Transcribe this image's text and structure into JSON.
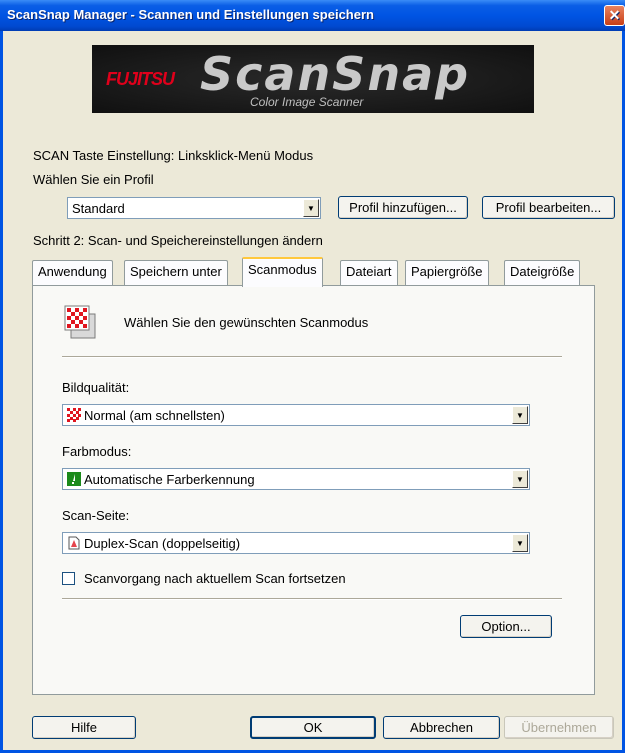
{
  "window": {
    "title": "ScanSnap Manager - Scannen und Einstellungen speichern",
    "close_glyph": "✕"
  },
  "banner": {
    "brand": "FUJITSU",
    "product": "ScanSnap",
    "subtitle": "Color Image Scanner"
  },
  "scan_key_setting": "SCAN Taste Einstellung: Linksklick-Menü Modus",
  "profile": {
    "label": "Wählen Sie ein Profil",
    "selected": "Standard",
    "add_button": "Profil hinzufügen...",
    "edit_button": "Profil bearbeiten..."
  },
  "step_label": "Schritt 2: Scan- und Speichereinstellungen ändern",
  "tabs": [
    {
      "label": "Anwendung"
    },
    {
      "label": "Speichern unter"
    },
    {
      "label": "Scanmodus"
    },
    {
      "label": "Dateiart"
    },
    {
      "label": "Papiergröße"
    },
    {
      "label": "Dateigröße"
    }
  ],
  "active_tab": "Scanmodus",
  "scanmode": {
    "heading": "Wählen Sie den gewünschten Scanmodus",
    "image_quality": {
      "label": "Bildqualität:",
      "selected": "Normal (am schnellsten)"
    },
    "color_mode": {
      "label": "Farbmodus:",
      "selected": "Automatische Farberkennung"
    },
    "scan_side": {
      "label": "Scan-Seite:",
      "selected": "Duplex-Scan (doppelseitig)"
    },
    "continue_checkbox": {
      "label": "Scanvorgang nach aktuellem Scan fortsetzen",
      "checked": false
    },
    "option_button": "Option..."
  },
  "footer": {
    "help": "Hilfe",
    "ok": "OK",
    "cancel": "Abbrechen",
    "apply": "Übernehmen"
  },
  "colors": {
    "titlebar": "#0054e3",
    "tab_highlight": "#ffc83c",
    "dialog_bg": "#ece9d8"
  }
}
